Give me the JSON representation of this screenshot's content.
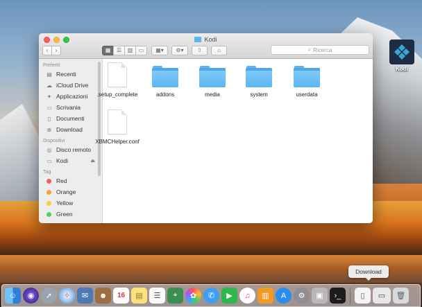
{
  "desktop": {
    "icon_label": "Kodi"
  },
  "window": {
    "title": "Kodi",
    "search_placeholder": "Ricerca"
  },
  "sidebar": {
    "sections": [
      {
        "heading": "Preferiti",
        "items": [
          {
            "label": "Recenti",
            "icon": "recents-icon"
          },
          {
            "label": "iCloud Drive",
            "icon": "cloud-icon"
          },
          {
            "label": "Applicazioni",
            "icon": "applications-icon"
          },
          {
            "label": "Scrivania",
            "icon": "desktop-icon"
          },
          {
            "label": "Documenti",
            "icon": "documents-icon"
          },
          {
            "label": "Download",
            "icon": "download-icon"
          }
        ]
      },
      {
        "heading": "Dispositivi",
        "items": [
          {
            "label": "Disco remoto",
            "icon": "disc-icon"
          },
          {
            "label": "Kodi",
            "icon": "drive-icon"
          }
        ]
      },
      {
        "heading": "Tag",
        "items": [
          {
            "label": "Red",
            "color": "#f25f5c"
          },
          {
            "label": "Orange",
            "color": "#f7a23b"
          },
          {
            "label": "Yellow",
            "color": "#f4d13d"
          },
          {
            "label": "Green",
            "color": "#5ccb5f"
          }
        ]
      }
    ]
  },
  "files": [
    {
      "name": ".setup_complete",
      "kind": "document"
    },
    {
      "name": "addons",
      "kind": "folder"
    },
    {
      "name": "media",
      "kind": "folder"
    },
    {
      "name": "system",
      "kind": "folder"
    },
    {
      "name": "userdata",
      "kind": "folder"
    },
    {
      "name": "XBMCHelper.conf",
      "kind": "document"
    }
  ],
  "dock": {
    "tooltip": "Download",
    "calendar_day": "16"
  }
}
